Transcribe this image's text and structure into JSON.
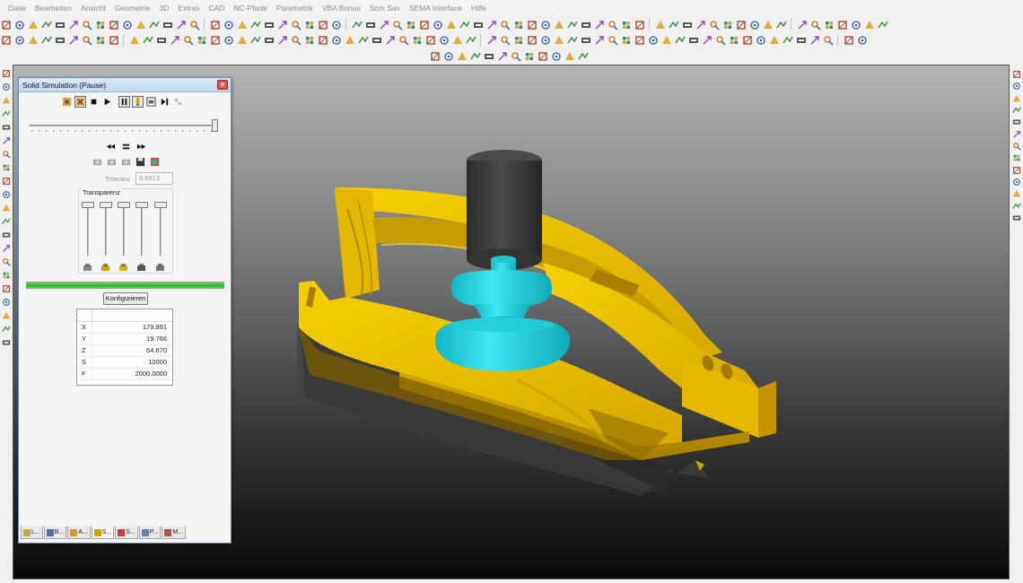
{
  "menubar": {
    "items": [
      "Datei",
      "Bearbeiten",
      "Ansicht",
      "Geometrie",
      "3D",
      "Extras",
      "CAD",
      "NC-Pfade",
      "Parametrik",
      "VBA Bonus",
      "Scm Sax",
      "SEMA Interface",
      "Hilfe"
    ]
  },
  "toolbar_icons": {
    "row1": [
      "new-icon",
      "open-icon",
      "save-icon",
      "save-as-icon",
      "import-icon",
      "export-icon",
      "print-icon",
      "plot-icon",
      "layer-icon",
      "snap-icon",
      "pin-icon",
      "stop-icon",
      "copy-icon",
      "grid-icon",
      "move-icon",
      "sep",
      "zoom-in-icon",
      "zoom-out-icon",
      "zoom-window-icon",
      "zoom-fit-icon",
      "pan-icon",
      "rotate-icon",
      "view-top-icon",
      "shade-icon",
      "wireframe-icon",
      "render-icon",
      "sep",
      "iso-icon",
      "front-icon",
      "side-icon",
      "back-icon",
      "top-icon",
      "bottom-icon",
      "undo-view-icon"
    ],
    "row2": [
      "line-icon",
      "arc-icon",
      "circle-icon",
      "rect-icon",
      "text-icon",
      "polygon-icon",
      "spline-icon",
      "point-icon",
      "fill-icon",
      "sep",
      "undo-icon",
      "redo-icon",
      "delete-icon",
      "trim-icon",
      "extend-icon",
      "offset-icon",
      "mirror-icon",
      "scale-icon",
      "array-icon",
      "fillet-icon",
      "chamfer-icon",
      "break-icon",
      "join-icon",
      "explode-icon",
      "measure-icon",
      "dimension-icon",
      "hatch-icon"
    ],
    "row3": [
      "nc-path-icon",
      "drill-icon",
      "pocket-icon",
      "profile-icon",
      "cut-icon",
      "engrave-icon",
      "grid-icon",
      "sim-icon"
    ],
    "left": [
      "pointer-icon",
      "cursor-icon",
      "line-tool-icon",
      "poly-tool-icon",
      "arc-tool-icon",
      "circle-tool-icon",
      "ellipse-tool-icon",
      "spline-tool-icon",
      "text-tool-icon",
      "hatch-tool-icon",
      "dim-tool-icon",
      "layer-tool-icon",
      "block-tool-icon",
      "snap-tool-icon",
      "grid-tool-icon",
      "ortho-tool-icon",
      "polar-tool-icon",
      "osnap-tool-icon",
      "measure-tool-icon"
    ],
    "right": [
      "move-right-icon",
      "grid-right-icon",
      "tile-right-icon",
      "layer-right-icon",
      "copy-right-icon",
      "table-right-icon",
      "edit-right-icon",
      "clip-right-icon",
      "clock-right-icon",
      "parts-right-icon",
      "stack-right-icon",
      "delete-right-icon",
      "close-right-icon"
    ]
  },
  "colors": {
    "part_yellow": "#f2c200",
    "tool_cyan": "#1fd8e6",
    "tool_holder": "#3a3a3a",
    "progress_green": "#2ab52a"
  },
  "sim": {
    "title": "Solid Simulation (Pause)",
    "close_label": "✕",
    "progress_position": 1.0,
    "tolerance_label": "Toleranz",
    "tolerance_value": "0.6913",
    "transparency_label": "Transparenz",
    "transparency_levels": [
      0,
      0,
      0,
      0,
      0
    ],
    "transparency_icons": [
      "stock-icon",
      "tool-icon",
      "holder-icon",
      "fixture-icon",
      "machine-icon"
    ],
    "progress_bar_fraction": 1.0,
    "configure_label": "Konfigurieren",
    "coords": [
      {
        "label": "X",
        "value": "179.891"
      },
      {
        "label": "Y",
        "value": "19.766"
      },
      {
        "label": "Z",
        "value": "64.670"
      },
      {
        "label": "S",
        "value": "10000"
      },
      {
        "label": "F",
        "value": "2000.0000"
      }
    ],
    "tabs": [
      {
        "label": "L...",
        "icon": "layers-icon"
      },
      {
        "label": "B...",
        "icon": "blocks-icon"
      },
      {
        "label": "A...",
        "icon": "attributes-icon"
      },
      {
        "label": "S...",
        "icon": "simulation-icon",
        "active": true
      },
      {
        "label": "S...",
        "icon": "settings-icon"
      },
      {
        "label": "P...",
        "icon": "properties-icon"
      },
      {
        "label": "M...",
        "icon": "macros-icon"
      }
    ]
  }
}
